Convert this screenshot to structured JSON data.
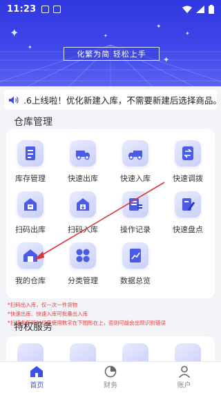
{
  "status": {
    "time": "11:23"
  },
  "banner": {
    "slogan": "化繁为简    轻松上手"
  },
  "notice": {
    "text": ".6上线啦！优化新建入库，不需要新建后选择商品。"
  },
  "warehouse": {
    "title": "仓库管理",
    "items": [
      {
        "label": "库存管理",
        "icon": "inventory-icon"
      },
      {
        "label": "快速出库",
        "icon": "quick-outbound-icon"
      },
      {
        "label": "快速入库",
        "icon": "quick-inbound-icon"
      },
      {
        "label": "快速调拨",
        "icon": "transfer-icon"
      },
      {
        "label": "扫码出库",
        "icon": "scan-outbound-icon"
      },
      {
        "label": "扫码入库",
        "icon": "scan-inbound-icon"
      },
      {
        "label": "操作记录",
        "icon": "operation-log-icon"
      },
      {
        "label": "快速盘点",
        "icon": "stocktake-icon"
      },
      {
        "label": "我的仓库",
        "icon": "my-warehouse-icon"
      },
      {
        "label": "分类管理",
        "icon": "category-icon"
      },
      {
        "label": "数据总览",
        "icon": "data-overview-icon"
      }
    ]
  },
  "tips": [
    "*扫码出入库，仅一次一件货物",
    "*快速出库、快速入库可批量出入库",
    "*扫描条形码时尽量使用数字在下图形在上，否则可能会出现识别错误"
  ],
  "privilege": {
    "title": "特权服务"
  },
  "tabbar": {
    "items": [
      {
        "label": "首页",
        "icon": "home-icon",
        "active": true
      },
      {
        "label": "财务",
        "icon": "finance-icon",
        "active": false
      },
      {
        "label": "账户",
        "icon": "account-icon",
        "active": false
      }
    ]
  },
  "colors": {
    "accent": "#3a50e8",
    "banner": "#3a41e6",
    "tip": "#e23b3b",
    "annotation_arrow": "#d9363e"
  }
}
